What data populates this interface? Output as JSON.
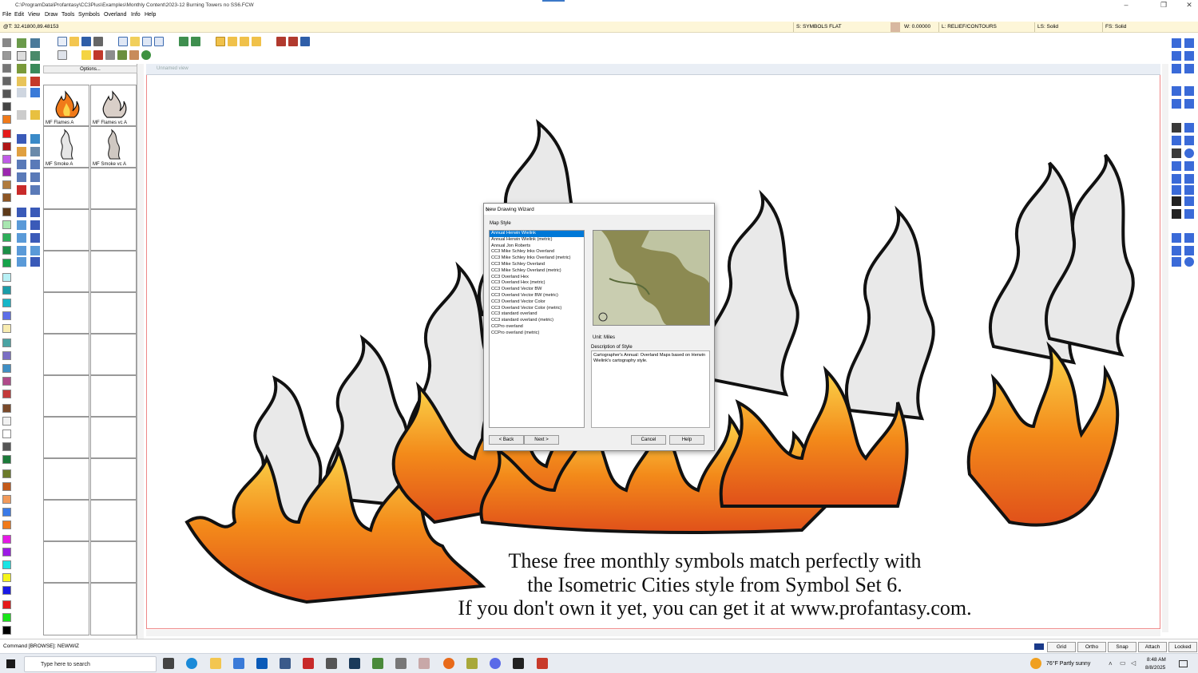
{
  "titlebar": {
    "path": "C:\\ProgramData\\Profantasy\\CC3Plus\\Examples\\Monthly Content\\2023-12 Burning Towers no SS6.FCW",
    "minimize": "–",
    "maximize": "❐",
    "close": "✕"
  },
  "menu": [
    "File",
    "Edit",
    "View",
    "Draw",
    "Tools",
    "Symbols",
    "Overland",
    "Info",
    "Help"
  ],
  "status": {
    "coords": "@T: 32.41800,89.48153",
    "sheet": "S: SYMBOLS FLAT",
    "width": "W: 0.00000",
    "layer": "L: RELIEF/CONTOURS",
    "line_style": "LS: Solid",
    "fill_style": "FS: Solid"
  },
  "catalog": {
    "options_label": "Options...",
    "items": [
      "MF Flames A",
      "MF Flames vc A",
      "MF Smoke A",
      "MF Smoke vc A"
    ]
  },
  "view": {
    "title": "Unnamed view"
  },
  "wizard": {
    "title": "New Drawing Wizard",
    "section_label": "Map Style",
    "styles": [
      "Annual Herwin Wielink",
      "Annual Herwin Wielink (metric)",
      "Annual Jon Roberts",
      "CC3 Mike Schley Inks Overland",
      "CC3 Mike Schley Inks Overland (metric)",
      "CC3 Mike Schley Overland",
      "CC3 Mike Schley Overland (metric)",
      "CC3 Overland Hex",
      "CC3 Overland Hex (metric)",
      "CC3 Overland Vector BW",
      "CC3 Overland Vector BW (metric)",
      "CC3 Overland Vector Color",
      "CC3 Overland Vector Color (metric)",
      "CC3 standard overland",
      "CC3 standard overland (metric)",
      "CCPro overland",
      "CCPro overland (metric)"
    ],
    "selected_index": 0,
    "unit": "Unit: Miles",
    "description_label": "Description of Style",
    "description": "Cartographer's Annual: Overland Maps based on Herwin Wielink's cartography style.",
    "back": "< Back",
    "next": "Next >",
    "cancel": "Cancel",
    "help": "Help",
    "close": "✕"
  },
  "caption": [
    "These free monthly symbols match perfectly with",
    "the Isometric Cities style from Symbol Set 6.",
    "If you don't own it yet, you can get it at www.profantasy.com."
  ],
  "command": {
    "text": "Command [BROWSE]: NEWWIZ"
  },
  "mode_buttons": [
    "Grid",
    "Ortho",
    "Snap",
    "Attach",
    "Locked"
  ],
  "taskbar": {
    "search_placeholder": "Type here to search",
    "weather": "76°F  Partly sunny",
    "time": "8:48 AM",
    "date": "8/8/2025"
  },
  "colors": {
    "status_bg": "#fdf6d8",
    "selection": "#0078d7",
    "canvas_border": "#ee8888"
  }
}
